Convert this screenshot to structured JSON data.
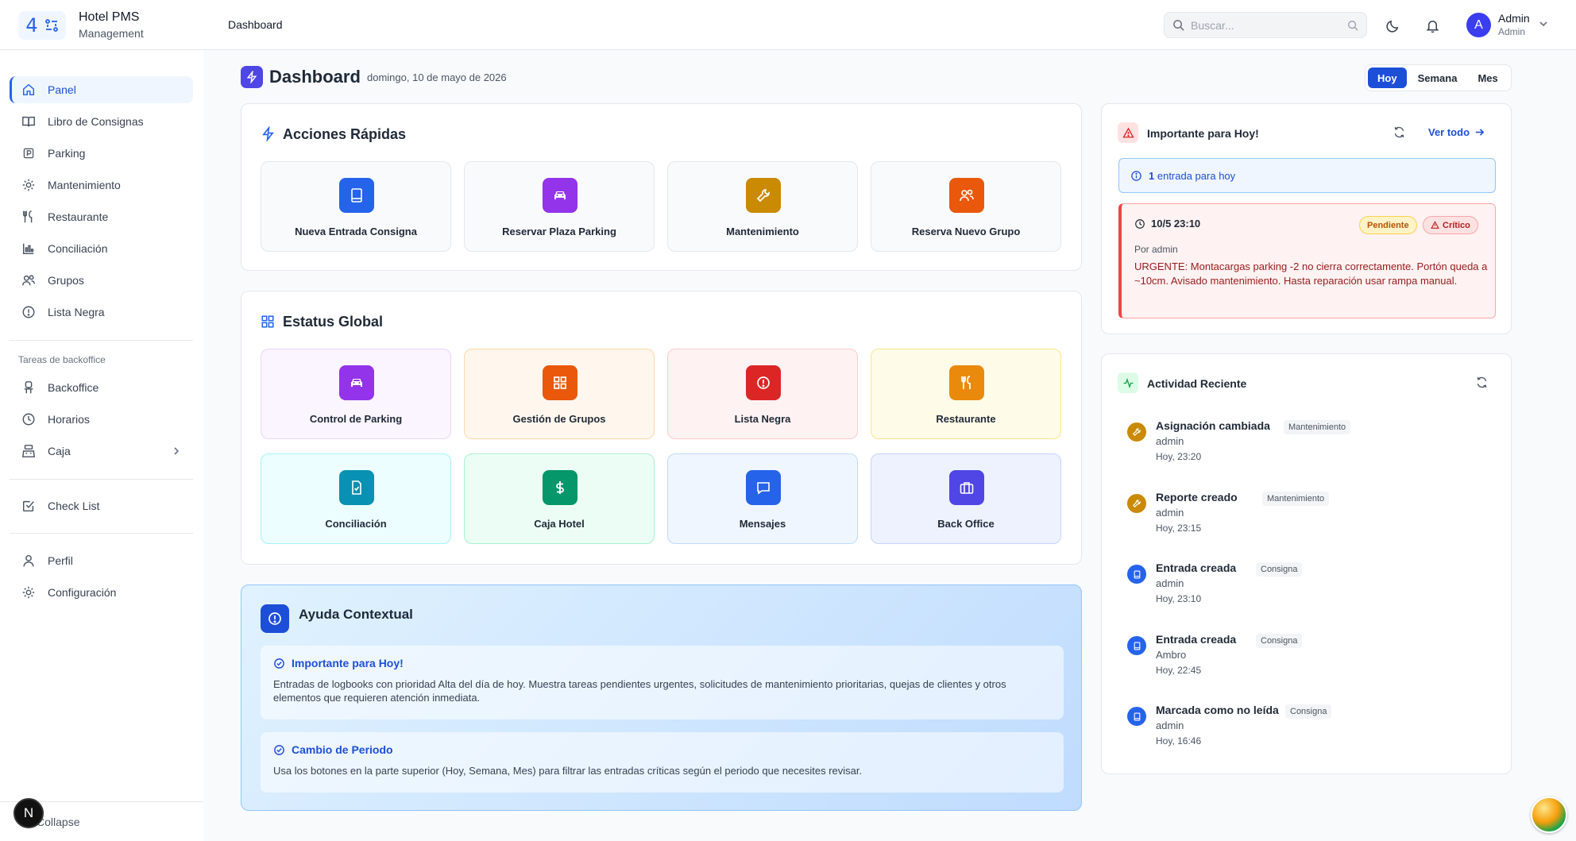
{
  "brand": {
    "title": "Hotel PMS",
    "subtitle": "Management",
    "logo_number": "4"
  },
  "header": {
    "breadcrumb": "Dashboard",
    "search_placeholder": "Buscar...",
    "user_name": "Admin",
    "user_role": "Admin",
    "avatar_letter": "A"
  },
  "sidebar": {
    "items": [
      {
        "label": "Panel",
        "icon": "home-icon"
      },
      {
        "label": "Libro de Consignas",
        "icon": "book-icon"
      },
      {
        "label": "Parking",
        "icon": "parking-icon"
      },
      {
        "label": "Mantenimiento",
        "icon": "gear-icon"
      },
      {
        "label": "Restaurante",
        "icon": "utensils-icon"
      },
      {
        "label": "Conciliación",
        "icon": "chart-icon"
      },
      {
        "label": "Grupos",
        "icon": "users-icon"
      },
      {
        "label": "Lista Negra",
        "icon": "alert-circle-icon"
      }
    ],
    "section_label": "Tareas de backoffice",
    "backoffice_items": [
      {
        "label": "Backoffice",
        "icon": "chair-icon"
      },
      {
        "label": "Horarios",
        "icon": "clock-icon"
      },
      {
        "label": "Caja",
        "icon": "register-icon"
      }
    ],
    "checklist": {
      "label": "Check List"
    },
    "profile_items": [
      {
        "label": "Perfil"
      },
      {
        "label": "Configuración"
      }
    ],
    "collapse_label": "Collapse",
    "badge_letter": "N"
  },
  "page": {
    "title": "Dashboard",
    "date": "domingo, 10 de mayo de 2026",
    "periods": [
      "Hoy",
      "Semana",
      "Mes"
    ],
    "active_period": "Hoy"
  },
  "quick_actions": {
    "title": "Acciones Rápidas",
    "items": [
      {
        "label": "Nueva Entrada Consigna",
        "color": "#2563eb"
      },
      {
        "label": "Reservar Plaza Parking",
        "color": "#9333ea"
      },
      {
        "label": "Mantenimiento",
        "color": "#ca8a04"
      },
      {
        "label": "Reserva Nuevo Grupo",
        "color": "#ea580c"
      }
    ]
  },
  "global_status": {
    "title": "Estatus Global",
    "items": [
      {
        "label": "Control de Parking",
        "color": "#9333ea",
        "bg": "#faf5ff"
      },
      {
        "label": "Gestión de Grupos",
        "color": "#ea580c",
        "bg": "#fff7ed"
      },
      {
        "label": "Lista Negra",
        "color": "#dc2626",
        "bg": "#fef2f2"
      },
      {
        "label": "Restaurante",
        "color": "#ea8a0c",
        "bg": "#fefce8"
      },
      {
        "label": "Conciliación",
        "color": "#0891b2",
        "bg": "#ecfeff"
      },
      {
        "label": "Caja Hotel",
        "color": "#059669",
        "bg": "#ecfdf5"
      },
      {
        "label": "Mensajes",
        "color": "#2563eb",
        "bg": "#eff6ff"
      },
      {
        "label": "Back Office",
        "color": "#4f46e5",
        "bg": "#eef2ff"
      }
    ]
  },
  "help": {
    "title": "Ayuda Contextual",
    "boxes": [
      {
        "heading": "Importante para Hoy!",
        "text": "Entradas de logbooks con prioridad Alta del día de hoy. Muestra tareas pendientes urgentes, solicitudes de mantenimiento prioritarias, quejas de clientes y otros elementos que requieren atención inmediata."
      },
      {
        "heading": "Cambio de Periodo",
        "text": "Usa los botones en la parte superior (Hoy, Semana, Mes) para filtrar las entradas críticas según el periodo que necesites revisar."
      }
    ]
  },
  "important": {
    "title": "Importante para Hoy!",
    "view_all": "Ver todo",
    "count": "1",
    "count_text": "entrada para hoy",
    "entry": {
      "time": "10/5 23:10",
      "status": "Pendiente",
      "priority": "Crítico",
      "author": "Por admin",
      "text": "URGENTE: Montacargas parking -2 no cierra correctamente. Portón queda a ~10cm. Avisado mantenimiento. Hasta reparación usar rampa manual."
    }
  },
  "activity": {
    "title": "Actividad Reciente",
    "items": [
      {
        "title": "Asignación cambiada",
        "tag": "Mantenimiento",
        "user": "admin",
        "when": "Hoy, 23:20",
        "color": "#ca8a04"
      },
      {
        "title": "Reporte creado",
        "tag": "Mantenimiento",
        "user": "admin",
        "when": "Hoy, 23:15",
        "color": "#ca8a04"
      },
      {
        "title": "Entrada creada",
        "tag": "Consigna",
        "user": "admin",
        "when": "Hoy, 23:10",
        "color": "#2563eb"
      },
      {
        "title": "Entrada creada",
        "tag": "Consigna",
        "user": "Ambro",
        "when": "Hoy, 22:45",
        "color": "#2563eb"
      },
      {
        "title": "Marcada como no leída",
        "tag": "Consigna",
        "user": "admin",
        "when": "Hoy, 16:46",
        "color": "#2563eb"
      }
    ]
  }
}
